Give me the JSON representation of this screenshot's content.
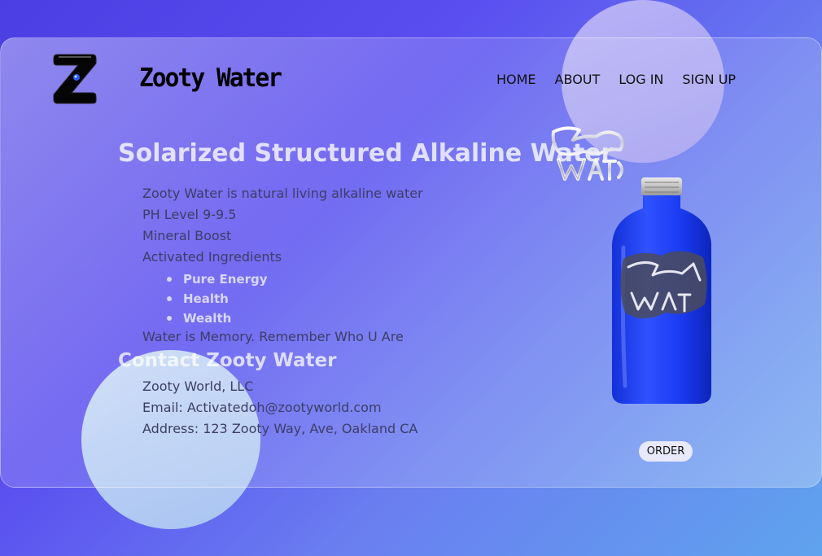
{
  "brand": {
    "name": "Zooty Water"
  },
  "nav": {
    "home": "HOME",
    "about": "ABOUT",
    "login": "LOG IN",
    "signup": "SIGN UP"
  },
  "hero": {
    "headline": "Solarized Structured Alkaline Water",
    "lines": [
      "Zooty Water is natural living alkaline water",
      "PH Level 9-9.5",
      "Mineral Boost",
      "Activated Ingredients"
    ],
    "ingredients": [
      "Pure Energy",
      "Health",
      "Wealth"
    ],
    "tagline": "Water is Memory. Remember Who U Are"
  },
  "contact": {
    "title": "Contact Zooty Water",
    "company": "Zooty World, LLC",
    "email": "Email: Activatedoh@zootyworld.com",
    "address": "Address: 123 Zooty Way, Ave, Oakland CA"
  },
  "order": {
    "label": "ORDER"
  },
  "colors": {
    "accent": "#4b3fe3",
    "bottle": "#1c38e8",
    "text": "#3d3d66"
  },
  "icons": {
    "logo": "z-logo-icon",
    "sticker": "zooty-water-graffiti-logo",
    "product": "blue-water-bottle"
  }
}
